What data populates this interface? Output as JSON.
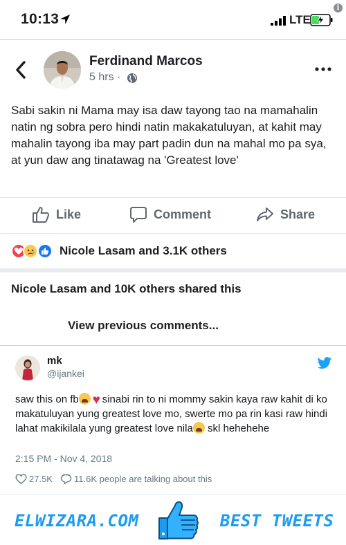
{
  "status_bar": {
    "time": "10:13",
    "network": "LTE",
    "info_badge": "i"
  },
  "post": {
    "author": "Ferdinand Marcos",
    "time": "5 hrs ·",
    "text": "Sabi sakin ni Mama may isa daw tayong tao na mamahalin natin ng sobra pero hindi natin makakatuluyan, at kahit may mahalin tayong iba may part padin dun na mahal mo pa sya, at yun daw ang tinatawag na 'Greatest love'",
    "actions": {
      "like": "Like",
      "comment": "Comment",
      "share": "Share"
    },
    "reactions_text": "Nicole Lasam and 3.1K others",
    "shared_text": "Nicole Lasam and 10K others shared this",
    "view_previous": "View previous comments..."
  },
  "tweet": {
    "name": "mk",
    "handle": "@ijankei",
    "text_part1": "saw this on fb",
    "text_part2": "sinabi rin to ni mommy sakin kaya raw kahit di ko makatuluyan yung greatest love mo, swerte mo pa rin kasi raw hindi lahat makikilala yung greatest love nila",
    "text_part3": " skl hehehehe",
    "date": "2:15 PM - Nov 4, 2018",
    "likes": "27.5K",
    "talking": "11.6K people are talking about this"
  },
  "branding": {
    "site": "ELWIZARA.COM",
    "tagline": "BEST TWEETS"
  },
  "colors": {
    "twitter_blue": "#1d9bf0",
    "fb_gray_text": "#606770",
    "love": "#f33e58",
    "like": "#1877f2"
  }
}
